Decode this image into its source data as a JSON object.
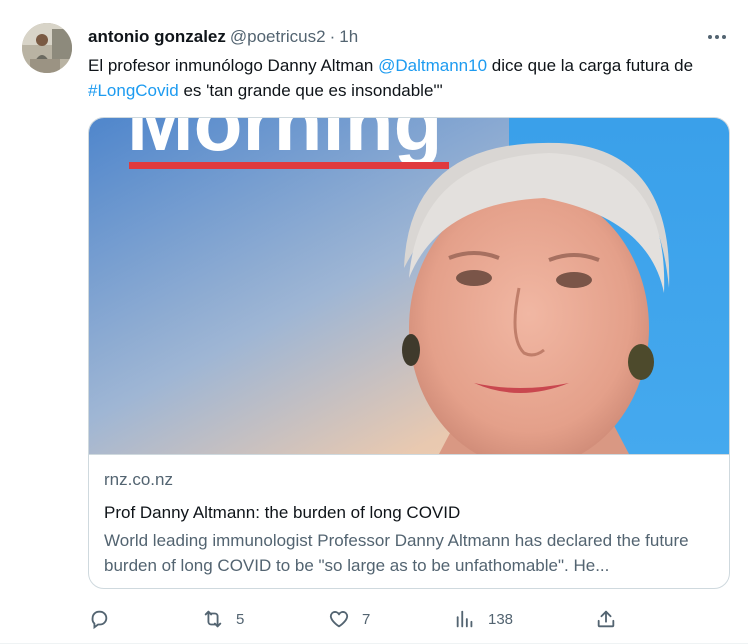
{
  "tweet": {
    "author": {
      "display_name": "antonio gonzalez",
      "handle": "@poetricus2",
      "time": "1h",
      "separator": "·"
    },
    "text_parts": {
      "part1": "El profesor inmunólogo Danny Altman ",
      "mention": "@Daltmann10",
      "part2": " dice que la carga futura de ",
      "hashtag": "#LongCovid",
      "part3": " es 'tan grande que es insondable'\""
    },
    "card": {
      "image_overlay_text": "Morning",
      "domain": "rnz.co.nz",
      "title": "Prof Danny Altmann: the burden of long COVID",
      "description": "World leading immunologist Professor Danny Altmann has declared the future burden of long COVID to be \"so large as to be unfathomable\". He..."
    },
    "actions": {
      "reply_icon": "reply-icon",
      "retweet_icon": "retweet-icon",
      "retweet_count": "5",
      "like_icon": "heart-icon",
      "like_count": "7",
      "views_icon": "views-icon",
      "views_count": "138",
      "share_icon": "share-icon"
    }
  },
  "colors": {
    "link": "#1d9bf0",
    "secondary_text": "#536471",
    "primary_text": "#0f1419",
    "border": "#cfd9de"
  }
}
